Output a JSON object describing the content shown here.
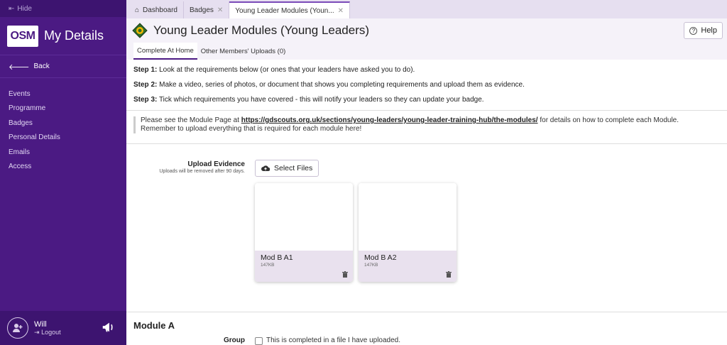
{
  "sidebar": {
    "hide_label": "Hide",
    "brand_logo_text": "OSM",
    "brand_title": "My Details",
    "back_label": "Back",
    "nav_items": [
      {
        "label": "Events"
      },
      {
        "label": "Programme"
      },
      {
        "label": "Badges"
      },
      {
        "label": "Personal Details"
      },
      {
        "label": "Emails"
      },
      {
        "label": "Access"
      }
    ],
    "user_name": "Will",
    "logout_label": "Logout"
  },
  "tabs": [
    {
      "label": "Dashboard",
      "icon": "home-icon"
    },
    {
      "label": "Badges"
    },
    {
      "label": "Young Leader Modules (Youn..."
    }
  ],
  "page": {
    "title": "Young Leader Modules (Young Leaders)",
    "help_label": "Help",
    "subtabs": [
      "Complete At Home",
      "Other Members' Uploads (0)"
    ]
  },
  "steps": [
    {
      "num": "Step 1:",
      "text": " Look at the requirements below (or ones that your leaders have asked you to do)."
    },
    {
      "num": "Step 2:",
      "text": " Make a video, series of photos, or document that shows you completing requirements and upload them as evidence."
    },
    {
      "num": "Step 3:",
      "text": " Tick which requirements you have covered - this will notify your leaders so they can update your badge."
    }
  ],
  "notice": {
    "prefix": "Please see the Module Page at ",
    "link": "https://gdscouts.org.uk/sections/young-leaders/young-leader-training-hub/the-modules/",
    "suffix": " for details on how to complete each Module.",
    "line2": "Remember to upload everything that is required for each module here!"
  },
  "upload": {
    "label": "Upload Evidence",
    "sublabel": "Uploads will be removed after 90 days.",
    "button_label": "Select Files",
    "files": [
      {
        "name": "Mod B A1",
        "size": "147KB"
      },
      {
        "name": "Mod B A2",
        "size": "147KB"
      }
    ]
  },
  "module_a": {
    "title": "Module A",
    "group_label": "Group",
    "checkbox_text": "This is completed in a file I have uploaded."
  },
  "colors": {
    "sidebar": "#4b1a83",
    "accent": "#7a4ab8"
  }
}
